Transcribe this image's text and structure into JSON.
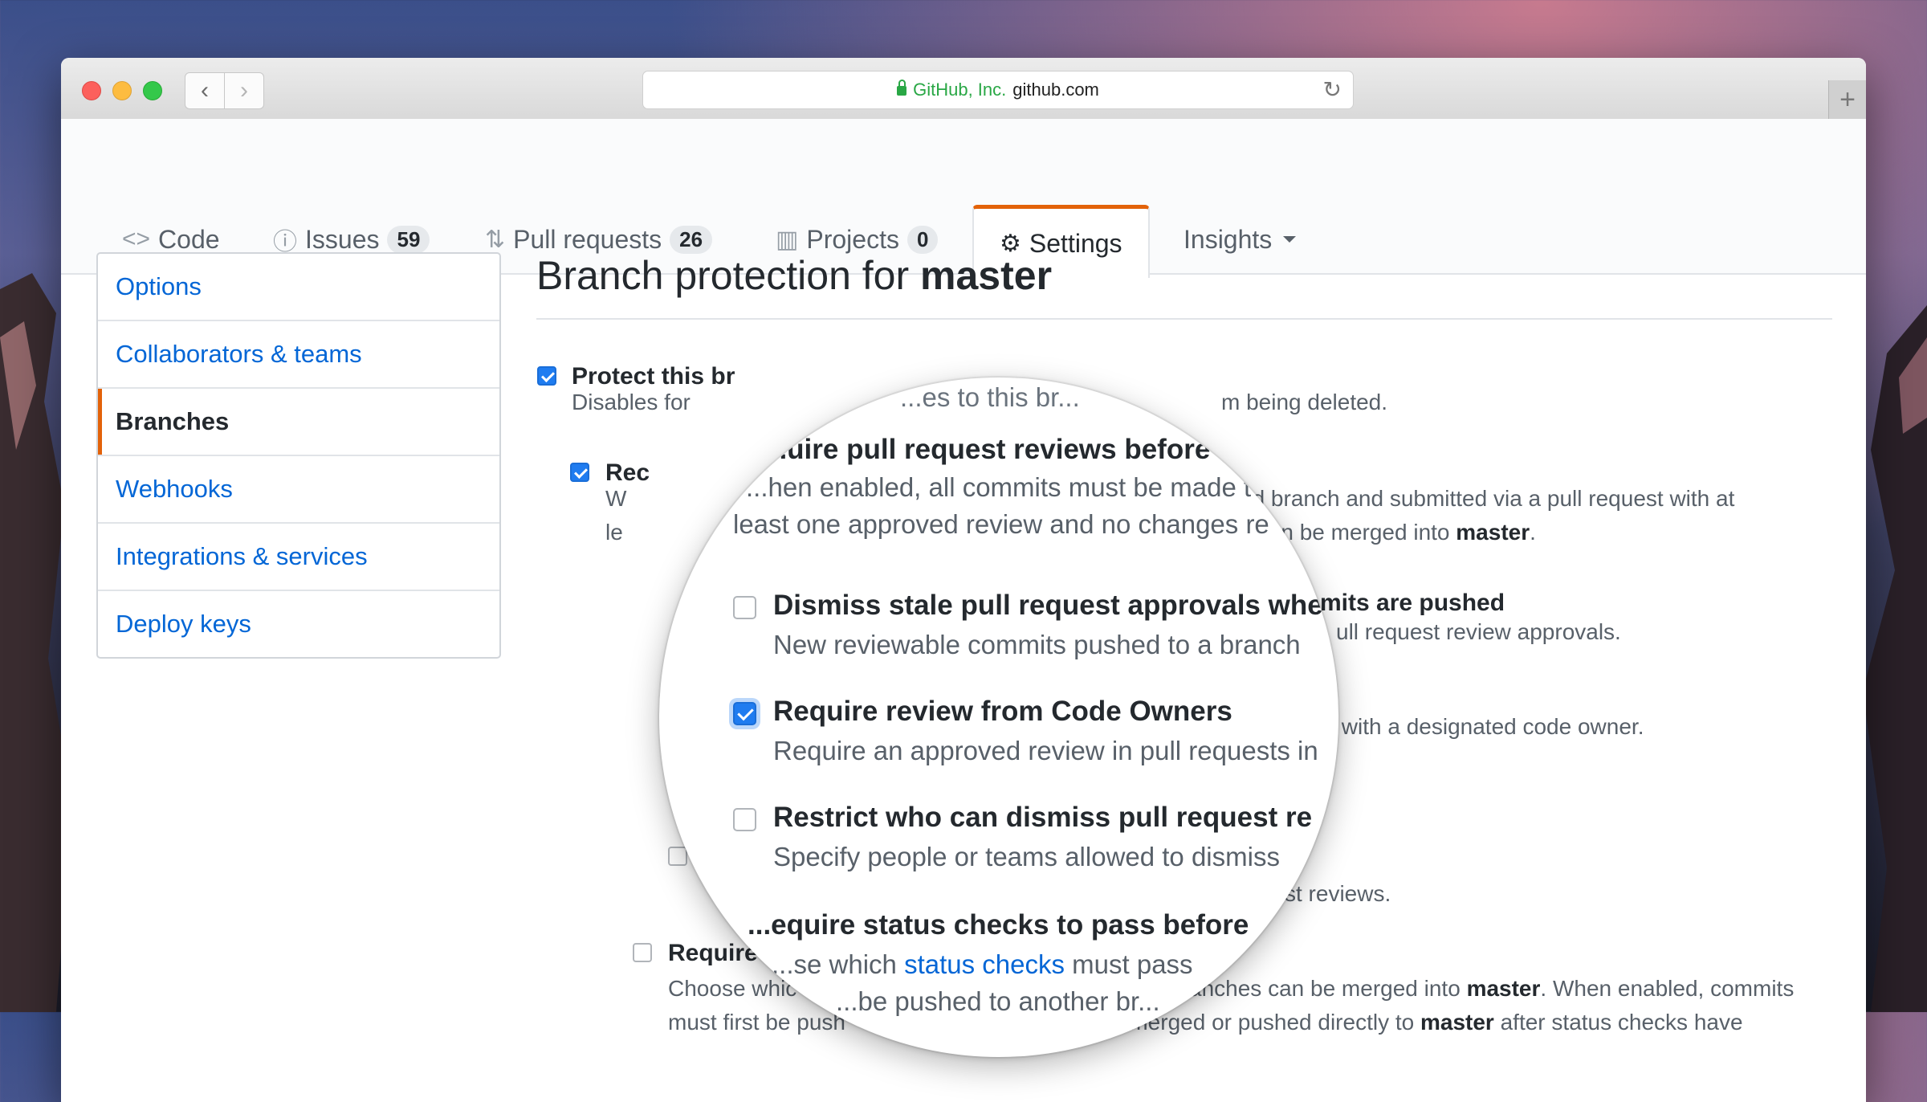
{
  "browser": {
    "company": "GitHub, Inc.",
    "domain": "github.com",
    "back": "‹",
    "forward": "›",
    "reload": "↻",
    "new_tab": "+"
  },
  "tabs": [
    {
      "label": "Code",
      "icon": "code-icon",
      "glyph": "<>",
      "counter": ""
    },
    {
      "label": "Issues",
      "icon": "issue-icon",
      "glyph": "ⓘ",
      "counter": "59"
    },
    {
      "label": "Pull requests",
      "icon": "pull-request-icon",
      "glyph": "⇅",
      "counter": "26"
    },
    {
      "label": "Projects",
      "icon": "project-icon",
      "glyph": "▥",
      "counter": "0"
    },
    {
      "label": "Settings",
      "icon": "gear-icon",
      "glyph": "⚙",
      "counter": "",
      "selected": true
    },
    {
      "label": "Insights",
      "icon": "chevron-down-icon",
      "counter": ""
    }
  ],
  "sidebar": {
    "items": [
      {
        "label": "Options"
      },
      {
        "label": "Collaborators & teams"
      },
      {
        "label": "Branches",
        "selected": true
      },
      {
        "label": "Webhooks"
      },
      {
        "label": "Integrations & services"
      },
      {
        "label": "Deploy keys"
      }
    ]
  },
  "main": {
    "title_prefix": "Branch protection for ",
    "title_branch": "master",
    "protect": {
      "title": "Protect this br",
      "desc": "Disables for",
      "desc_end": "m being deleted."
    },
    "reviews": {
      "title": "Rec",
      "desc_a": "W",
      "desc_a_end": "ed branch and submitted via a pull request with at",
      "desc_b": "le",
      "desc_b_end": "it can be merged into ",
      "desc_b_branch": "master",
      "desc_b_period": "."
    },
    "stale": {
      "title_end": "mits are pushed",
      "desc_end": "ull request review approvals."
    },
    "owners": {
      "desc_end": "s with a designated code owner."
    },
    "restrict": {
      "desc_end": "st reviews."
    },
    "status": {
      "title": "Require",
      "line1_start": "Choose whic",
      "line1_end": "anches can be merged into ",
      "line1_branch": "master",
      "line1_rest": ". When enabled, commits",
      "line2_start": "must first be push",
      "line2_mid": "n merged or pushed directly to ",
      "line2_branch": "master",
      "line2_end": " after status checks have"
    }
  },
  "magnifier": {
    "top_fragment": "...es to this br...",
    "require_reviews_title": "...uire pull request reviews before",
    "require_reviews_desc1": "...hen enabled, all commits must be made t",
    "require_reviews_desc2": "least one approved review and no changes re",
    "dismiss_stale_title": "Dismiss stale pull request approvals whe",
    "dismiss_stale_desc": "New reviewable commits pushed to a branch",
    "code_owners_title": "Require review from Code Owners",
    "code_owners_desc": "Require an approved review in pull requests in",
    "restrict_title": "Restrict who can dismiss pull request re",
    "restrict_desc": "Specify people or teams allowed to dismiss",
    "status_title": "...equire status checks to pass before",
    "status_desc_start": "...se which ",
    "status_desc_link": "status checks",
    "status_desc_end": " must pass",
    "pushed_fragment": "...be pushed to another br..."
  },
  "colors": {
    "accent_orange": "#e36209",
    "link_blue": "#0366d6",
    "checkbox_blue": "#1f7cf0",
    "text_dark": "#24292e",
    "text_muted": "#586069"
  }
}
